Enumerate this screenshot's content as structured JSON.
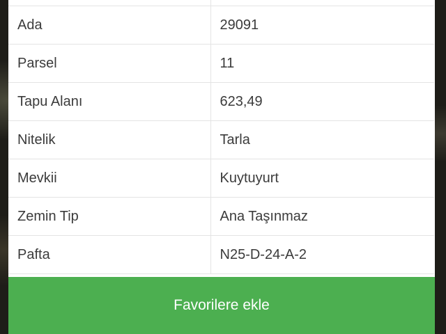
{
  "details": {
    "rows": [
      {
        "label": "",
        "value": ""
      },
      {
        "label": "Ada",
        "value": "29091"
      },
      {
        "label": "Parsel",
        "value": "11"
      },
      {
        "label": "Tapu Alanı",
        "value": "623,49"
      },
      {
        "label": "Nitelik",
        "value": "Tarla"
      },
      {
        "label": "Mevkii",
        "value": "Kuytuyurt"
      },
      {
        "label": "Zemin Tip",
        "value": "Ana Taşınmaz"
      },
      {
        "label": "Pafta",
        "value": "N25-D-24-A-2"
      }
    ]
  },
  "actions": {
    "favorite_label": "Favorilere ekle"
  },
  "colors": {
    "button_green": "#4caf50",
    "backdrop": "#1e1d18"
  }
}
